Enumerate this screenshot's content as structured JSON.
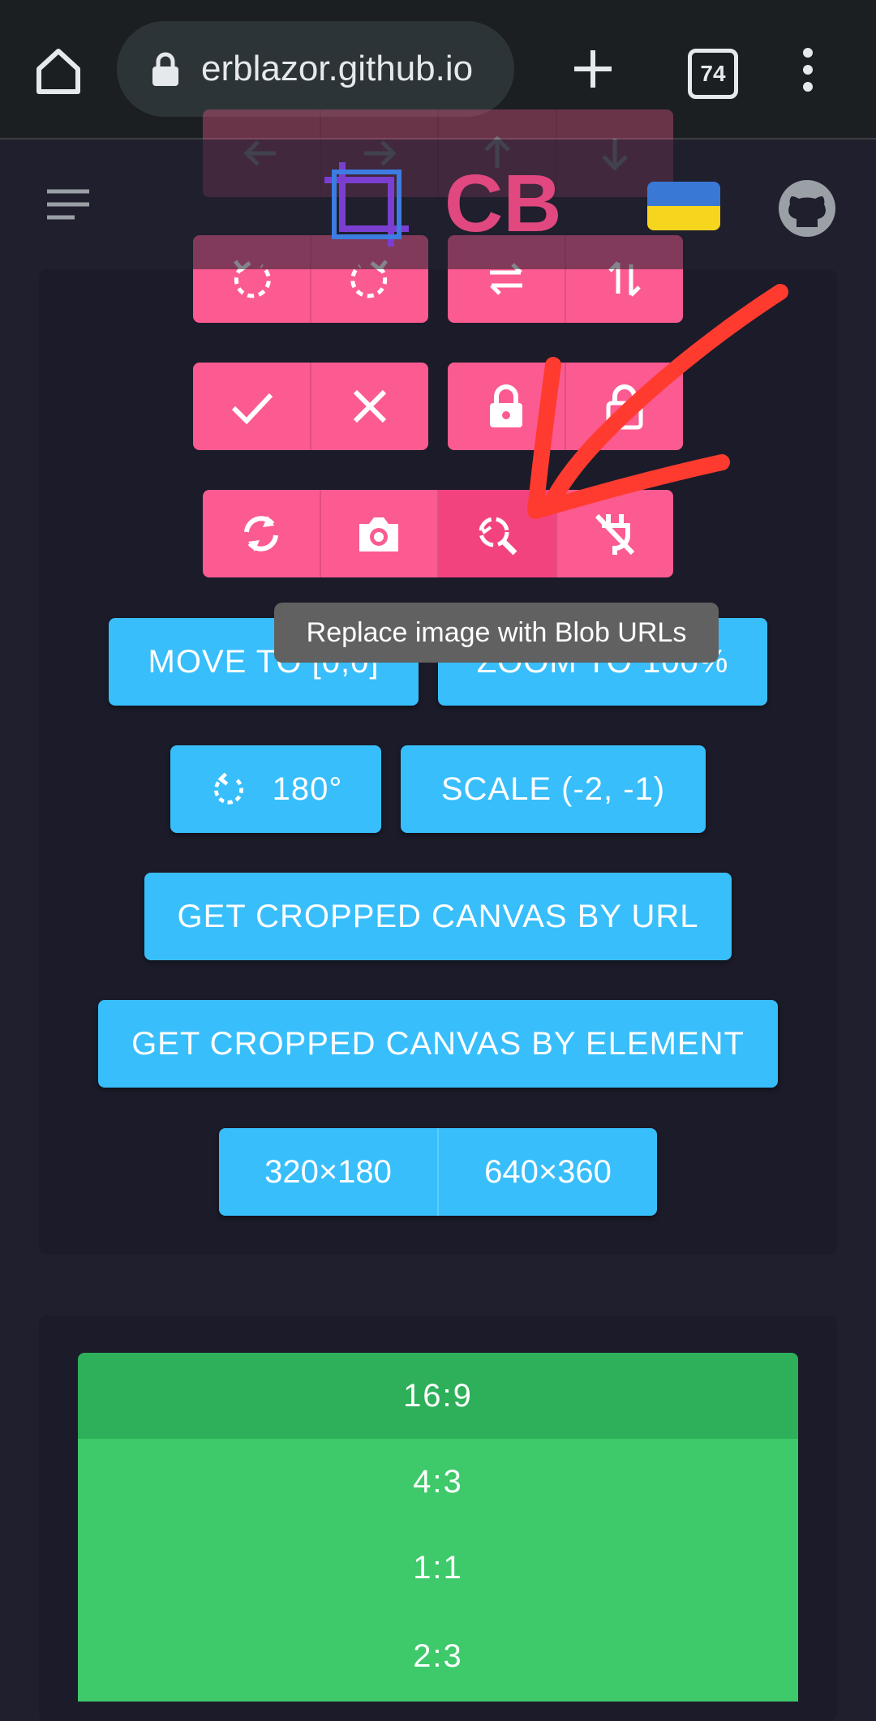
{
  "browser": {
    "url": "erblazor.github.io",
    "tab_count": "74"
  },
  "header": {
    "logo_text": "CB"
  },
  "tooltip": "Replace image with Blob URLs",
  "buttons": {
    "move_to": "MOVE TO [0,0]",
    "zoom_to": "ZOOM TO 100%",
    "rotate_180": "180°",
    "scale": "SCALE (-2, -1)",
    "canvas_by_url": "GET CROPPED CANVAS BY URL",
    "canvas_by_element": "GET CROPPED CANVAS BY ELEMENT",
    "size_small": "320×180",
    "size_large": "640×360"
  },
  "aspect_ratios": [
    "16:9",
    "4:3",
    "1:1",
    "2:3"
  ],
  "colors": {
    "accent_pink": "#fb5b90",
    "accent_blue": "#38befb",
    "accent_green": "#3ec96a",
    "accent_green_selected": "#2eaf59",
    "annotation_red": "#ff3b30"
  }
}
